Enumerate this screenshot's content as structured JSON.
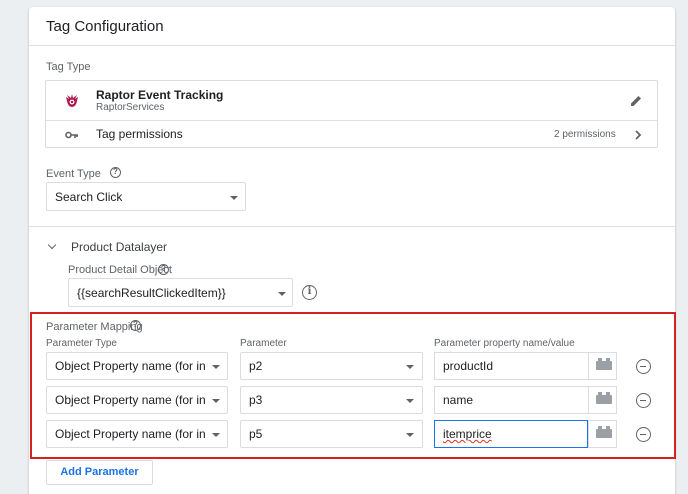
{
  "panel": {
    "title": "Tag Configuration"
  },
  "tag_type": {
    "section_label": "Tag Type",
    "name": "Raptor Event Tracking",
    "vendor": "RaptorServices",
    "permissions_label": "Tag permissions",
    "permissions_count": "2 permissions"
  },
  "event_type": {
    "label": "Event Type",
    "value": "Search Click"
  },
  "product_datalayer": {
    "section_label": "Product Datalayer",
    "field_label": "Product Detail Object",
    "value": "{{searchResultClickedItem}}"
  },
  "parameter_mapping": {
    "label": "Parameter Mapping",
    "col_type": "Parameter Type",
    "col_param": "Parameter",
    "col_value": "Parameter property name/value",
    "rows": [
      {
        "type": "Object Property name (for instance",
        "param": "p2",
        "value": "productId"
      },
      {
        "type": "Object Property name (for instance",
        "param": "p3",
        "value": "name"
      },
      {
        "type": "Object Property name (for instance",
        "param": "p5",
        "value": "itemprice"
      }
    ],
    "add_label": "Add Parameter"
  },
  "colors": {
    "accent": "#1a73e8",
    "highlight": "#d62121",
    "raptor": "#b0194c"
  }
}
